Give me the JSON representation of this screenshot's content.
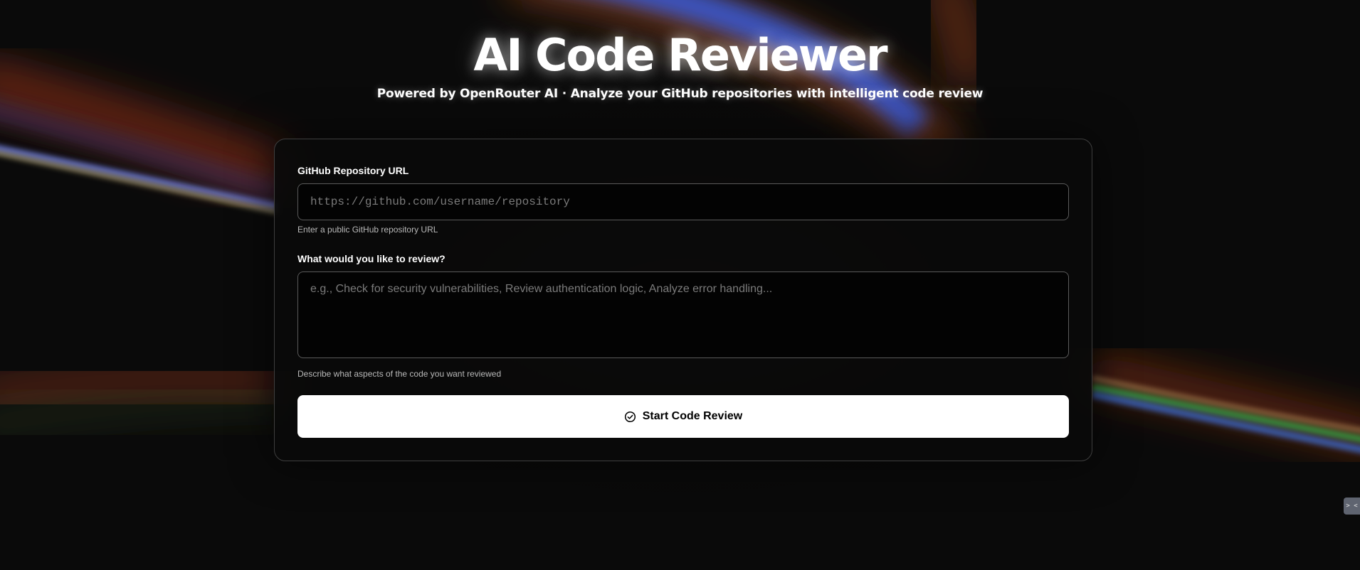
{
  "header": {
    "title": "AI Code Reviewer",
    "subtitle": "Powered by OpenRouter AI · Analyze your GitHub repositories with intelligent code review"
  },
  "form": {
    "repo_url": {
      "label": "GitHub Repository URL",
      "placeholder": "https://github.com/username/repository",
      "value": "",
      "hint": "Enter a public GitHub repository URL"
    },
    "review_request": {
      "label": "What would you like to review?",
      "placeholder": "e.g., Check for security vulnerabilities, Review authentication logic, Analyze error handling...",
      "value": "",
      "hint": "Describe what aspects of the code you want reviewed"
    },
    "submit": {
      "label": "Start Code Review",
      "icon": "check-circle-icon"
    }
  },
  "corner_widget": {
    "label": "> <",
    "icon": "terminal-icon"
  },
  "colors": {
    "background": "#0a0a0a",
    "card_background": "#0a0a0a",
    "card_border": "#3e3e3e",
    "input_border": "#5a5a5a",
    "button_background": "#ffffff",
    "button_text": "#000000",
    "accent_blue": "#3a6cff",
    "accent_orange": "#c4471b"
  }
}
